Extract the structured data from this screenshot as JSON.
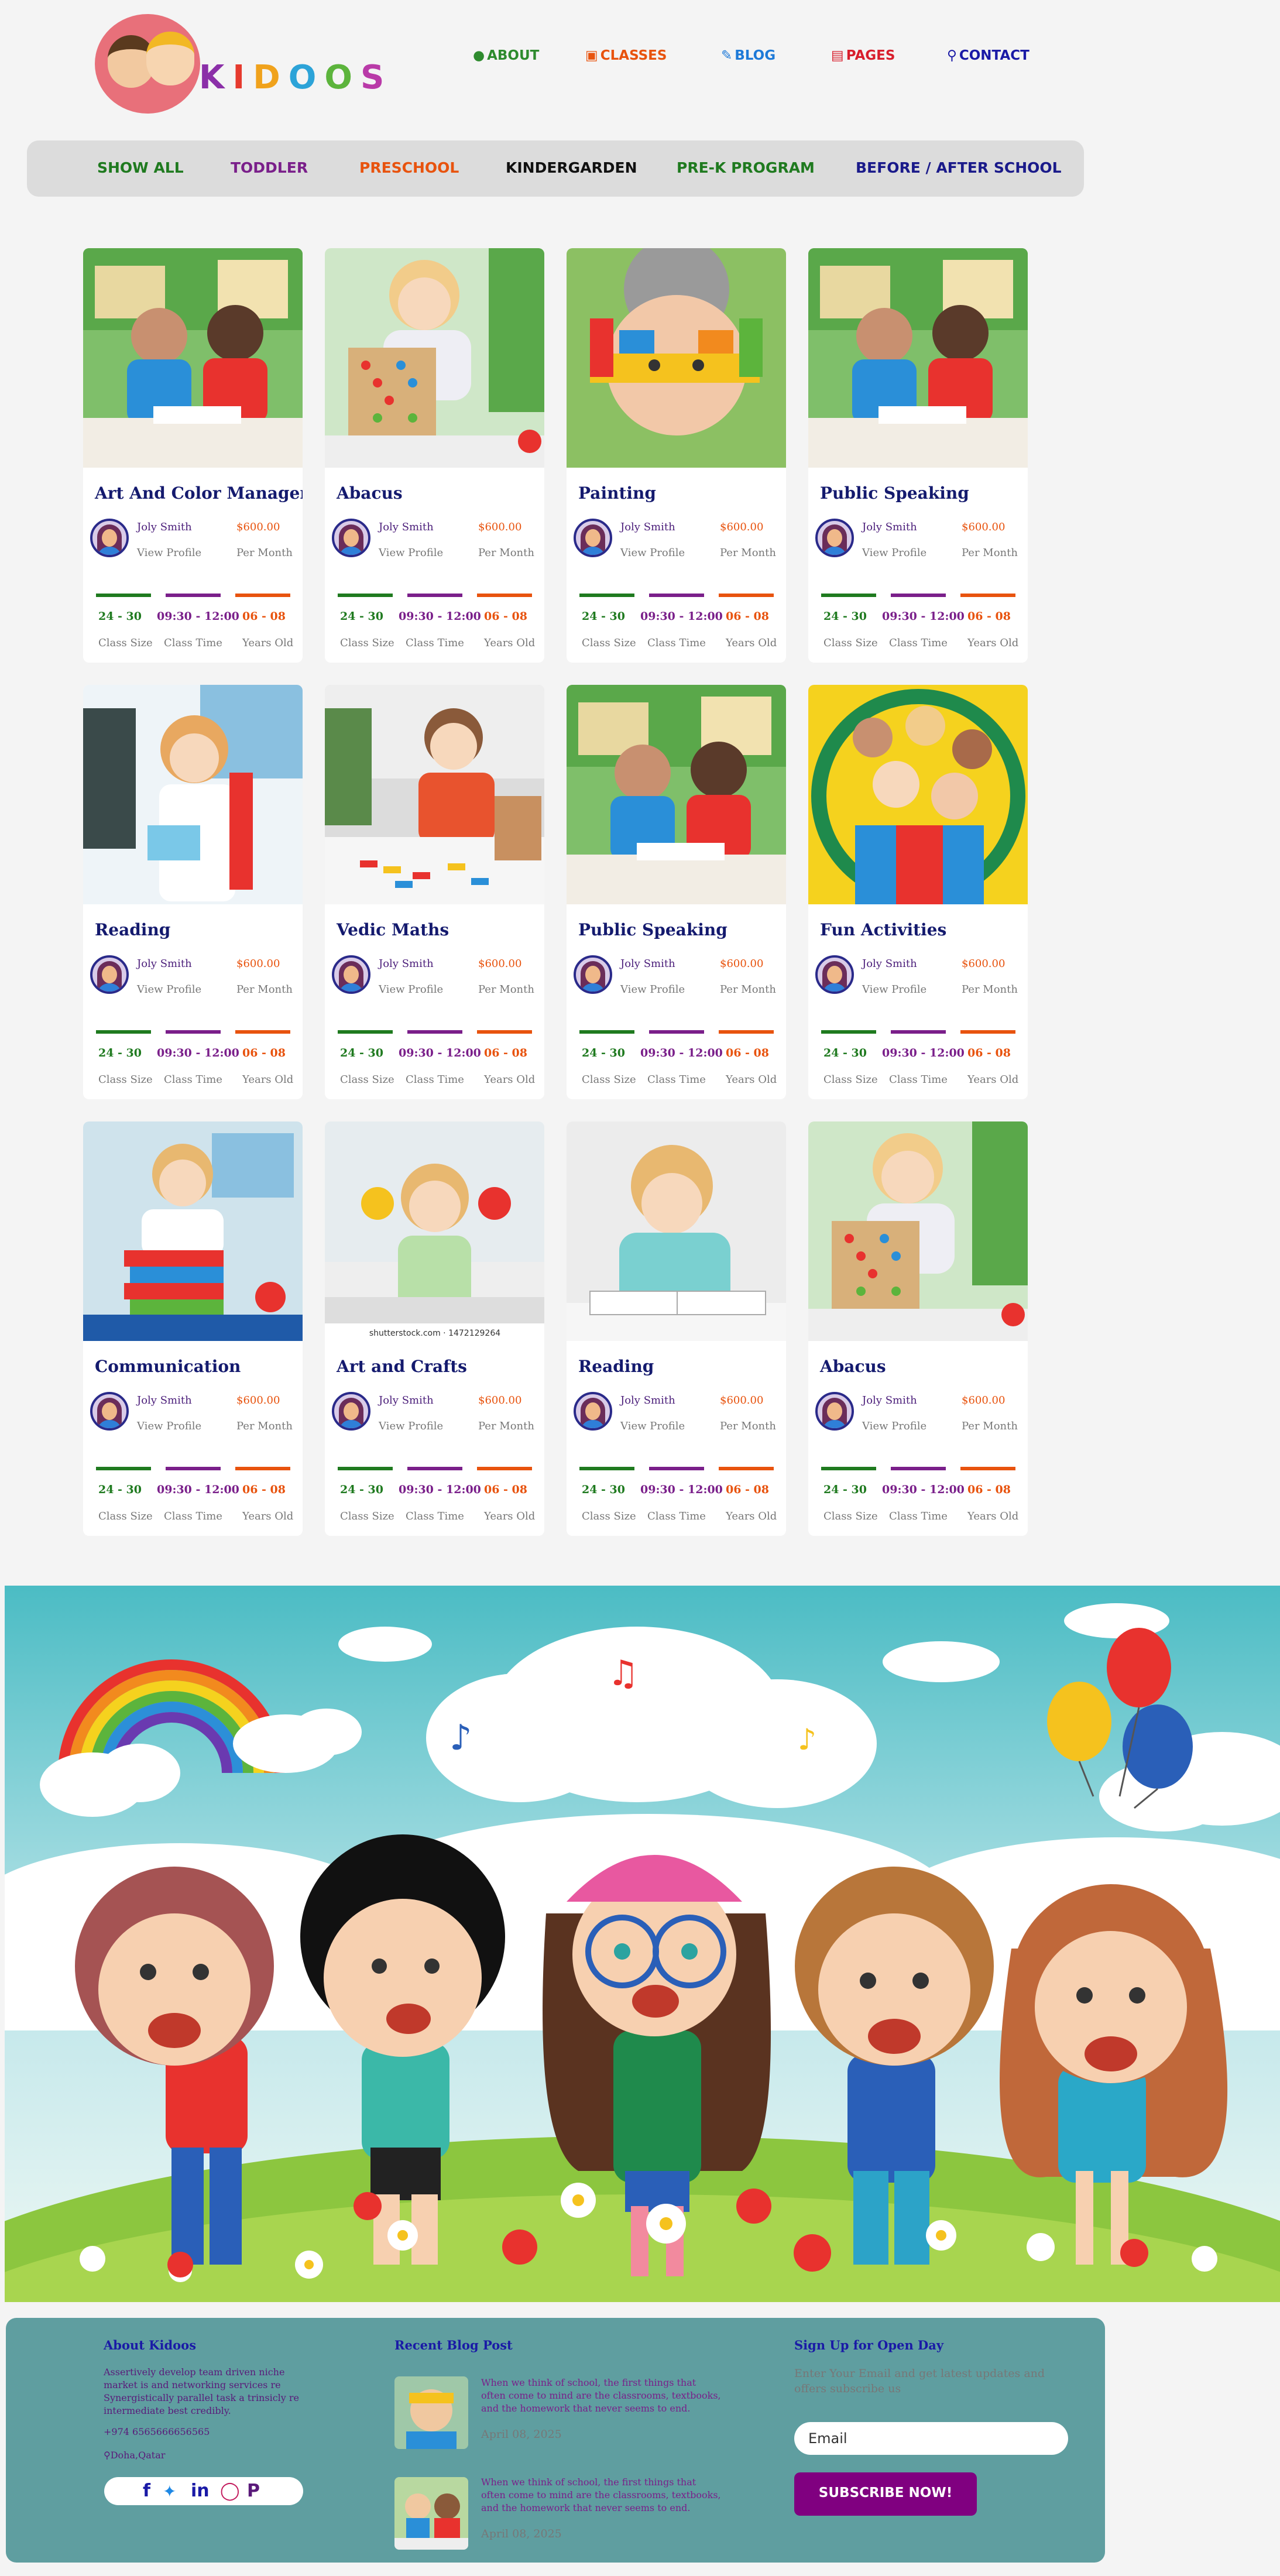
{
  "brand": {
    "name_letters": [
      "K",
      "I",
      "D",
      "O",
      "O",
      "S"
    ]
  },
  "topnav": [
    {
      "label": "ABOUT",
      "icon": "user-icon",
      "color": "#2e8b2e"
    },
    {
      "label": "CLASSES",
      "icon": "book-icon",
      "color": "#e8530e"
    },
    {
      "label": "BLOG",
      "icon": "edit-icon",
      "color": "#1e7ad8"
    },
    {
      "label": "PAGES",
      "icon": "document-icon",
      "color": "#d81e2c"
    },
    {
      "label": "CONTACT",
      "icon": "map-marker-icon",
      "color": "#1a1aa6"
    }
  ],
  "filters": [
    {
      "label": "SHOW ALL",
      "color": "#1f7a1f"
    },
    {
      "label": "TODDLER",
      "color": "#7a1f8a"
    },
    {
      "label": "PRESCHOOL",
      "color": "#e8530e"
    },
    {
      "label": "KINDERGARDEN",
      "color": "#111111"
    },
    {
      "label": "PRE-K PROGRAM",
      "color": "#1f7a1f"
    },
    {
      "label": "BEFORE / AFTER SCHOOL",
      "color": "#1a1a8a"
    }
  ],
  "card_common": {
    "author": "Joly Smith",
    "profile": "View Profile",
    "price": "$600.00",
    "per": "Per Month",
    "stats": [
      {
        "value": "24 - 30",
        "label": "Class Size",
        "color": "#1f7a1f"
      },
      {
        "value": "09:30 - 12:00",
        "label": "Class Time",
        "color": "#7a1f8a"
      },
      {
        "value": "06 - 08",
        "label": "Years Old",
        "color": "#e8530e"
      }
    ]
  },
  "cards": [
    {
      "title": "Art And Color Management",
      "image": "two-boys-classroom"
    },
    {
      "title": "Abacus",
      "image": "girl-abacus"
    },
    {
      "title": "Painting",
      "image": "child-painted-hands"
    },
    {
      "title": "Public Speaking",
      "image": "two-boys-classroom"
    },
    {
      "title": "Reading",
      "image": "girl-with-book"
    },
    {
      "title": "Vedic Maths",
      "image": "boy-abacus"
    },
    {
      "title": "Public Speaking",
      "image": "two-boys-classroom"
    },
    {
      "title": "Fun Activities",
      "image": "kids-in-hoop"
    },
    {
      "title": "Communication",
      "image": "girl-with-books-stack"
    },
    {
      "title": "Art and Crafts",
      "image": "girl-painted-hands",
      "caption": "shutterstock.com · 1472129264"
    },
    {
      "title": "Reading",
      "image": "girl-reading"
    },
    {
      "title": "Abacus",
      "image": "girl-abacus"
    }
  ],
  "footer": {
    "about": {
      "heading": "About Kidoos",
      "text": "Assertively develop team driven niche market is and networking services re Synergistically parallel task a trinsicly re intermediate best credibly.",
      "phone": "+974 6565666656565",
      "location": "Doha,Qatar"
    },
    "social_icons": [
      "facebook-icon",
      "twitter-icon",
      "linkedin-icon",
      "instagram-icon",
      "pinterest-icon"
    ],
    "blog": {
      "heading": "Recent Blog Post",
      "posts": [
        {
          "text": "When we think of school, the first things that often come to mind are the classrooms, textbooks, and the homework that never seems to end.",
          "date": "April 08, 2025"
        },
        {
          "text": "When we think of school, the first things that often come to mind are the classrooms, textbooks, and the homework that never seems to end.",
          "date": "April 08, 2025"
        }
      ]
    },
    "signup": {
      "heading": "Sign Up for Open Day",
      "text": "Enter Your Email and get latest updates and offers subscribe us",
      "placeholder": "Email",
      "button": "SUBSCRIBE NOW!"
    }
  }
}
